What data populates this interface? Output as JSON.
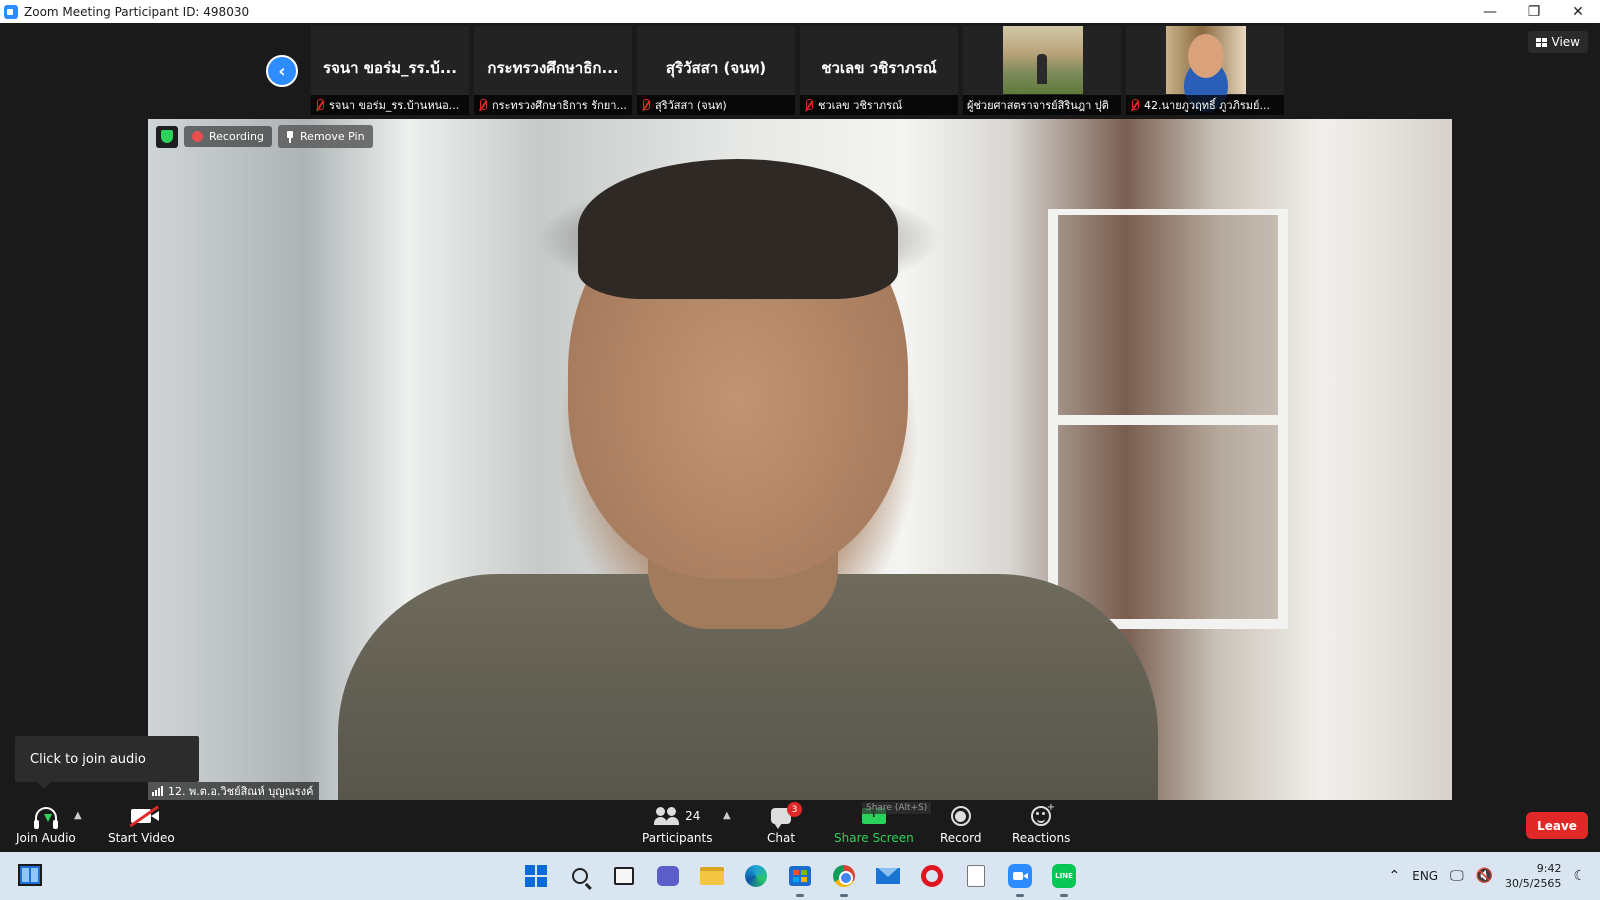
{
  "window": {
    "title": "Zoom Meeting Participant ID: 498030",
    "controls": [
      "—",
      "❐",
      "✕"
    ]
  },
  "thumbnails": [
    {
      "display_name": "รจนา ขอร่ม_รร.บ้...",
      "label": "รจนา ขอร่ม_รร.บ้านหนอ...",
      "muted": true
    },
    {
      "display_name": "กระทรวงศึกษาธิก...",
      "label": "กระทรวงศึกษาธิการ รักยา...",
      "muted": true
    },
    {
      "display_name": "สุริวัสสา (จนท)",
      "label": "สุริวัสสา (จนท)",
      "muted": true
    },
    {
      "display_name": "ชวเลข วชิราภรณ์",
      "label": "ชวเลข วชิราภรณ์",
      "muted": true
    },
    {
      "display_name": "",
      "label": "ผู้ช่วยศาสตราจารย์สิรินฎา ปุติ",
      "muted": false
    },
    {
      "display_name": "",
      "label": "42.นายภูวฤทธิ์ ภูวภิรมย์...",
      "muted": true
    }
  ],
  "view_button": "View",
  "main_video": {
    "recording_label": "Recording",
    "remove_pin_label": "Remove Pin",
    "speaker_name": "12. พ.ต.อ.วิชย์สิณห์ บุญณรงค์"
  },
  "tooltip": "Click to join audio",
  "toolbar": {
    "join_audio": "Join Audio",
    "start_video": "Start Video",
    "participants": "Participants",
    "participants_count": "24",
    "chat": "Chat",
    "chat_badge": "3",
    "share_screen": "Share Screen",
    "share_tip": "Share (Alt+S)",
    "record": "Record",
    "reactions": "Reactions",
    "leave": "Leave"
  },
  "taskbar": {
    "apps": [
      "start",
      "search",
      "task-view",
      "teams",
      "file-explorer",
      "edge",
      "store",
      "chrome",
      "mail",
      "opera",
      "notepad",
      "zoom",
      "line"
    ],
    "line_label": "LINE",
    "language": "ENG",
    "time": "9:42",
    "date": "30/5/2565"
  },
  "colors": {
    "accent": "#2d8cff",
    "leave": "#e02828",
    "share": "#2bd15a",
    "taskbar": "#d9e6f2"
  }
}
